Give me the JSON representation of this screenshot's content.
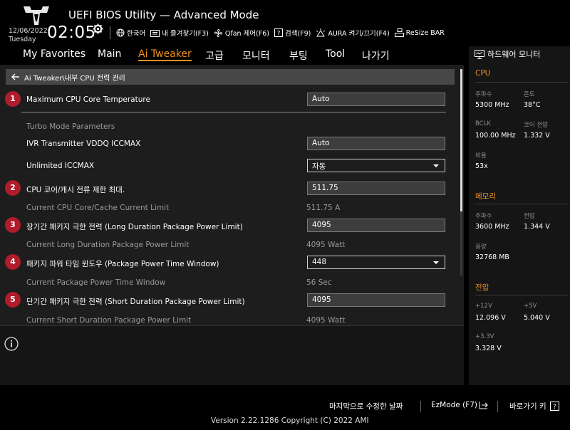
{
  "header": {
    "title": "UEFI BIOS Utility — Advanced Mode",
    "date": "12/06/2022",
    "weekday": "Tuesday",
    "time": "02:05",
    "toolbar": [
      {
        "icon": "globe-icon",
        "label": "한국어"
      },
      {
        "icon": "export-icon",
        "label": "내 즐겨찾기(F3)"
      },
      {
        "icon": "fan-icon",
        "label": "Qfan 제어(F6)"
      },
      {
        "icon": "search-help-icon",
        "label": "검색(F9)"
      },
      {
        "icon": "aura-icon",
        "label": "AURA 켜기/끄기(F4)"
      },
      {
        "icon": "resize-bar-icon",
        "label": "ReSize BAR"
      }
    ]
  },
  "nav": {
    "tabs": [
      "My Favorites",
      "Main",
      "Ai Tweaker",
      "고급",
      "모니터",
      "부팅",
      "Tool",
      "나가기"
    ],
    "active": "Ai Tweaker"
  },
  "breadcrumb": "Ai Tweaker\\내부 CPU 전력 관리",
  "settings": [
    {
      "badge": "1",
      "label": "Maximum CPU Core Temperature",
      "value": "Auto",
      "kind": "field"
    },
    {
      "badge": "",
      "label": "Turbo Mode Parameters",
      "value": "",
      "kind": "section"
    },
    {
      "badge": "",
      "label": "IVR Transmitter VDDQ ICCMAX",
      "value": "Auto",
      "kind": "field"
    },
    {
      "badge": "",
      "label": "Unlimited ICCMAX",
      "value": "자동",
      "kind": "select"
    },
    {
      "badge": "2",
      "label": "CPU 코어/캐시 전류 제한 최대.",
      "value": "511.75",
      "kind": "field"
    },
    {
      "badge": "",
      "label": "Current CPU Core/Cache Current Limit",
      "value": "511.75 A",
      "kind": "readonly"
    },
    {
      "badge": "3",
      "label": "장기간 패키지 극한 전력 (Long Duration Package Power Limit)",
      "value": "4095",
      "kind": "field"
    },
    {
      "badge": "",
      "label": "Current Long Duration Package Power Limit",
      "value": "4095 Watt",
      "kind": "readonly"
    },
    {
      "badge": "4",
      "label": "패키지 파워 타임 윈도우 (Package Power Time Window)",
      "value": "448",
      "kind": "select"
    },
    {
      "badge": "",
      "label": "Current Package Power Time Window",
      "value": "56 Sec",
      "kind": "readonly"
    },
    {
      "badge": "5",
      "label": "단기간 패키지 극한 전력 (Short Duration Package Power Limit)",
      "value": "4095",
      "kind": "field"
    },
    {
      "badge": "",
      "label": "Current Short Duration Package Power Limit",
      "value": "4095 Watt",
      "kind": "readonly"
    }
  ],
  "monitor": {
    "title": "하드웨어 모니터",
    "cpu": {
      "title": "CPU",
      "freq_label": "주파수",
      "freq": "5300 MHz",
      "temp_label": "온도",
      "temp": "38°C",
      "bclk_label": "BCLK",
      "bclk": "100.00 MHz",
      "vcore_label": "코어 전압",
      "vcore": "1.332 V",
      "ratio_label": "비율",
      "ratio": "53x"
    },
    "memory": {
      "title": "메모리",
      "freq_label": "주파수",
      "freq": "3600 MHz",
      "volt_label": "전압",
      "volt": "1.344 V",
      "cap_label": "용량",
      "cap": "32768 MB"
    },
    "voltage": {
      "title": "전압",
      "v12_label": "+12V",
      "v12": "12.096 V",
      "v5_label": "+5V",
      "v5": "5.040 V",
      "v33_label": "+3.3V",
      "v33": "3.328 V"
    }
  },
  "footer": {
    "last_modified": "마지막으로 수정한 날짜",
    "ezmode": "EzMode (F7)",
    "shortcut": "바로가기 키",
    "version": "Version 2.22.1286 Copyright (C) 2022 AMI"
  },
  "colors": {
    "accent": "#f09020",
    "badge": "#b01c2a",
    "panel": "#1d1d1d",
    "sidebar": "#151515"
  }
}
